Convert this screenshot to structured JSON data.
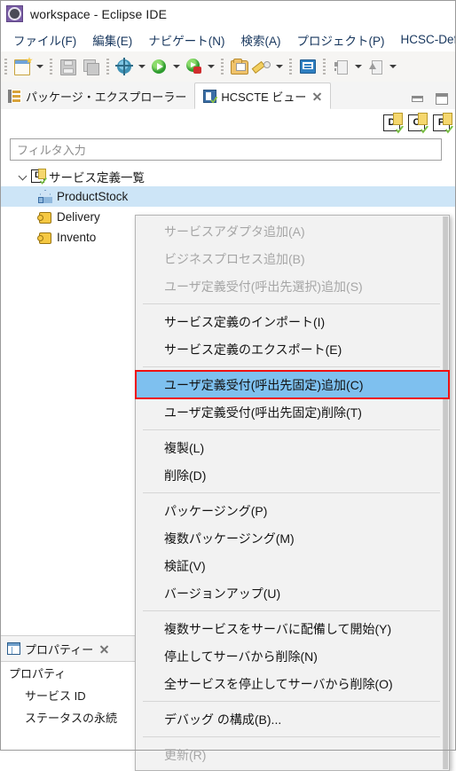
{
  "window": {
    "title": "workspace - Eclipse IDE",
    "app_icon": "eclipse-icon"
  },
  "menubar": {
    "items": [
      {
        "label": "ファイル(F)"
      },
      {
        "label": "編集(E)"
      },
      {
        "label": "ナビゲート(N)"
      },
      {
        "label": "検索(A)"
      },
      {
        "label": "プロジェクト(P)"
      },
      {
        "label": "HCSC-Def"
      }
    ]
  },
  "toolbar": {
    "buttons": [
      {
        "icon": "new-wizard-icon",
        "dropdown": true
      },
      {
        "icon": "save-icon",
        "dropdown": false
      },
      {
        "icon": "save-all-icon",
        "dropdown": false
      },
      {
        "icon": "debug-icon",
        "dropdown": true
      },
      {
        "icon": "run-icon",
        "dropdown": true
      },
      {
        "icon": "run-on-server-icon",
        "dropdown": true
      },
      {
        "icon": "open-folder-icon",
        "dropdown": false
      },
      {
        "icon": "edit-pen-icon",
        "dropdown": true
      },
      {
        "icon": "console-icon",
        "dropdown": false
      },
      {
        "icon": "import-icon",
        "dropdown": true
      },
      {
        "icon": "export-icon",
        "dropdown": true
      }
    ]
  },
  "tabs": {
    "items": [
      {
        "label": "パッケージ・エクスプローラー",
        "icon": "package-explorer-icon",
        "active": false,
        "closable": false
      },
      {
        "label": "HCSCTE ビュー",
        "icon": "hcscte-view-icon",
        "active": true,
        "closable": true
      }
    ],
    "window_buttons": [
      {
        "name": "minimize-button",
        "glyph": "minimize-icon"
      },
      {
        "name": "maximize-button",
        "glyph": "maximize-icon"
      }
    ]
  },
  "view_toolbar": {
    "buttons": [
      {
        "label": "D",
        "name": "definition-editor-button"
      },
      {
        "label": "C",
        "name": "component-editor-button"
      },
      {
        "label": "P",
        "name": "package-editor-button"
      }
    ]
  },
  "filter": {
    "placeholder": "フィルタ入力",
    "value": ""
  },
  "tree": {
    "root": {
      "label": "サービス定義一覧",
      "icon": "service-definition-list-icon",
      "expanded": true
    },
    "children": [
      {
        "label": "ProductStock",
        "icon": "business-process-icon",
        "selected": true
      },
      {
        "label": "Delivery",
        "icon": "service-adapter-icon",
        "selected": false
      },
      {
        "label": "Invento",
        "icon": "service-adapter-icon",
        "selected": false
      }
    ]
  },
  "properties": {
    "tab_label": "プロパティー",
    "header": "プロパティ",
    "rows": [
      {
        "label": "サービス ID"
      },
      {
        "label": "ステータスの永続"
      }
    ]
  },
  "context_menu": {
    "items": [
      {
        "label": "サービスアダプタ追加(A)",
        "state": "disabled"
      },
      {
        "label": "ビジネスプロセス追加(B)",
        "state": "disabled"
      },
      {
        "label": "ユーザ定義受付(呼出先選択)追加(S)",
        "state": "disabled"
      },
      {
        "separator": true
      },
      {
        "label": "サービス定義のインポート(I)",
        "state": "enabled"
      },
      {
        "label": "サービス定義のエクスポート(E)",
        "state": "enabled"
      },
      {
        "separator": true
      },
      {
        "label": "ユーザ定義受付(呼出先固定)追加(C)",
        "state": "highlighted"
      },
      {
        "label": "ユーザ定義受付(呼出先固定)削除(T)",
        "state": "enabled"
      },
      {
        "separator": true
      },
      {
        "label": "複製(L)",
        "state": "enabled"
      },
      {
        "label": "削除(D)",
        "state": "enabled"
      },
      {
        "separator": true
      },
      {
        "label": "パッケージング(P)",
        "state": "enabled"
      },
      {
        "label": "複数パッケージング(M)",
        "state": "enabled"
      },
      {
        "label": "検証(V)",
        "state": "enabled"
      },
      {
        "label": "バージョンアップ(U)",
        "state": "enabled"
      },
      {
        "separator": true
      },
      {
        "label": "複数サービスをサーバに配備して開始(Y)",
        "state": "enabled"
      },
      {
        "label": "停止してサーバから削除(N)",
        "state": "enabled"
      },
      {
        "label": "全サービスを停止してサーバから削除(O)",
        "state": "enabled"
      },
      {
        "separator": true
      },
      {
        "label": "デバッグ の構成(B)...",
        "state": "enabled"
      },
      {
        "separator": true
      },
      {
        "label": "更新(R)",
        "state": "disabled"
      }
    ]
  },
  "colors": {
    "highlight_background": "#7ec0ef",
    "highlight_outline": "#ee1111",
    "selection_background": "#cde5f7",
    "menu_text": "#17365d",
    "menu_background": "#f2f2f2"
  }
}
